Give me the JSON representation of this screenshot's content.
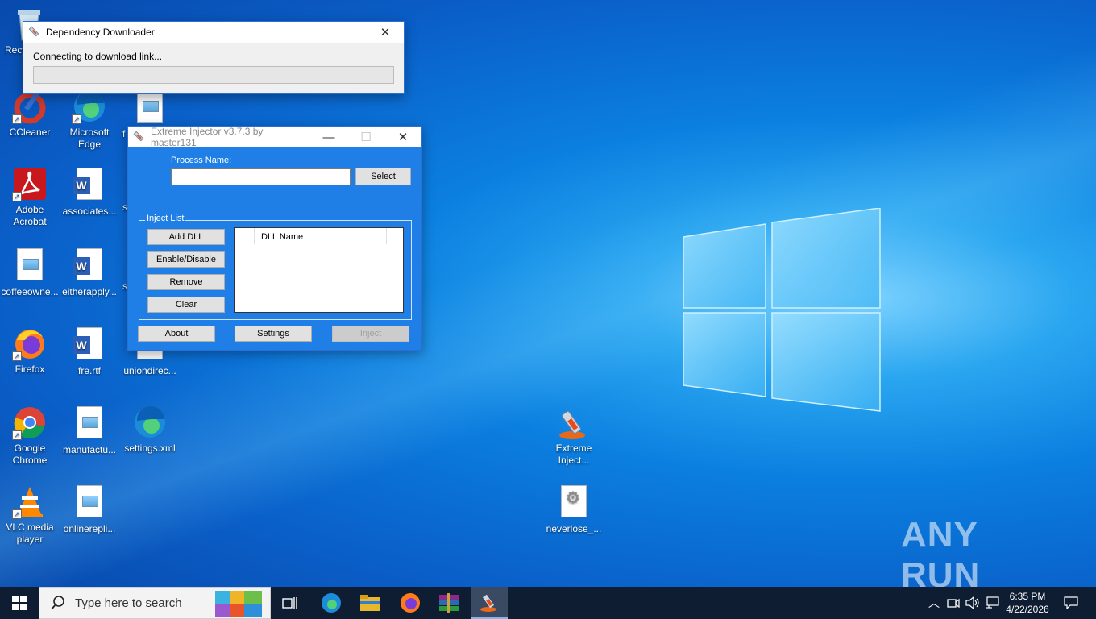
{
  "desktop": {
    "icons": [
      {
        "label": "Recy",
        "kind": "recycle"
      },
      {
        "label": "CCleaner",
        "kind": "ccleaner"
      },
      {
        "label": "Microsoft Edge",
        "kind": "edge"
      },
      {
        "label": "f",
        "kind": "image"
      },
      {
        "label": "Adobe Acrobat",
        "kind": "acrobat"
      },
      {
        "label": "associates...",
        "kind": "word"
      },
      {
        "label": "s",
        "kind": "blank"
      },
      {
        "label": "coffeeowne...",
        "kind": "image"
      },
      {
        "label": "eitherapply...",
        "kind": "word"
      },
      {
        "label": "s",
        "kind": "blank"
      },
      {
        "label": "Firefox",
        "kind": "firefox"
      },
      {
        "label": "fre.rtf",
        "kind": "word"
      },
      {
        "label": "uniondirec...",
        "kind": "image"
      },
      {
        "label": "Google Chrome",
        "kind": "chrome"
      },
      {
        "label": "manufactu...",
        "kind": "image"
      },
      {
        "label": "settings.xml",
        "kind": "edge"
      },
      {
        "label": "VLC media player",
        "kind": "vlc"
      },
      {
        "label": "onlinerepli...",
        "kind": "image"
      },
      {
        "label": "Extreme Inject...",
        "kind": "injector"
      },
      {
        "label": "neverlose_...",
        "kind": "gear"
      }
    ]
  },
  "downloader": {
    "title": "Dependency Downloader",
    "status": "Connecting to download link...",
    "progress": 0
  },
  "injector": {
    "title": "Extreme Injector v3.7.3 by master131",
    "process_label": "Process Name:",
    "process_value": "",
    "select_label": "Select",
    "inject_list_label": "Inject List",
    "add_dll": "Add DLL",
    "enable_disable": "Enable/Disable",
    "remove": "Remove",
    "clear": "Clear",
    "dll_column": "DLL Name",
    "about": "About",
    "settings": "Settings",
    "inject": "Inject"
  },
  "taskbar": {
    "search_placeholder": "Type here to search",
    "time": "6:35 PM",
    "date": "4/22/2026"
  },
  "watermark": "ANY RUN",
  "colors": {
    "accent": "#0078d7",
    "window_border": "#2a6fd6",
    "injector_body": "#1f7fe6"
  }
}
